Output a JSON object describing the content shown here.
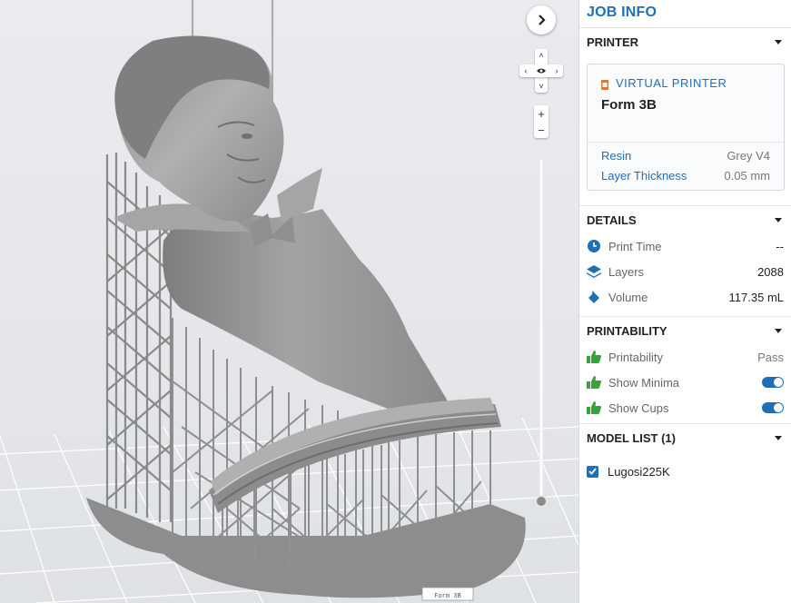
{
  "viewport": {
    "nav_arrow_icon": "chevron-right-icon",
    "zoom_in": "+",
    "zoom_out": "−",
    "tray_label": "Form 3B"
  },
  "panel": {
    "title": "JOB INFO",
    "printer": {
      "header": "PRINTER",
      "type_label": "VIRTUAL PRINTER",
      "name": "Form 3B",
      "rows": [
        {
          "key": "Resin",
          "value": "Grey V4"
        },
        {
          "key": "Layer Thickness",
          "value": "0.05 mm"
        }
      ]
    },
    "details": {
      "header": "DETAILS",
      "rows": [
        {
          "label": "Print Time",
          "value": "--",
          "icon": "clock-icon"
        },
        {
          "label": "Layers",
          "value": "2088",
          "icon": "layers-icon"
        },
        {
          "label": "Volume",
          "value": "117.35 mL",
          "icon": "volume-icon"
        }
      ]
    },
    "printability": {
      "header": "PRINTABILITY",
      "rows": [
        {
          "label": "Printability",
          "value": "Pass",
          "icon": "thumbs-up-icon"
        },
        {
          "label": "Show Minima",
          "icon": "thumbs-up-icon",
          "toggle": true
        },
        {
          "label": "Show Cups",
          "icon": "thumbs-up-icon",
          "toggle": true
        }
      ]
    },
    "model_list": {
      "header": "MODEL LIST (1)",
      "items": [
        {
          "name": "Lugosi225K",
          "checked": true
        }
      ]
    }
  },
  "colors": {
    "accent": "#1f6fb5",
    "green": "#3aa23a",
    "model": "#9a9a9a"
  }
}
